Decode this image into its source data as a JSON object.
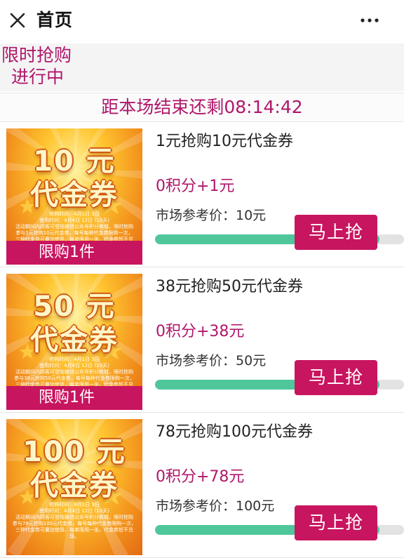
{
  "header": {
    "title": "首页",
    "close_icon": "close-icon",
    "more_icon": "more-dots-icon"
  },
  "tag": {
    "line1": "限时抢购",
    "line2": "进行中"
  },
  "countdown": {
    "text": "距本场结束还剩08:14:42"
  },
  "colors": {
    "accent": "#b0176b",
    "button": "#c8155f",
    "progress": "#4fc79a"
  },
  "items": [
    {
      "image": {
        "amount": "10 元",
        "kind": "代金券",
        "limit": "限购1件",
        "fine": [
          "抢购时间：4月1日 3日",
          "使用时间：4月4日 12日 (10天)",
          "活动期间内顾客可登陆微信公众号积分商城，限时抢购",
          "参与1元抢购10元代金券，每号每种代金券限购一次，",
          "三种代金券可叠加使用，每单限用一张，代金券恕不兑现。"
        ]
      },
      "name": "1元抢购10元代金券",
      "price": "0积分+1元",
      "market": "市场参考价：10元",
      "buy_label": "马上抢",
      "progress": 0.9
    },
    {
      "image": {
        "amount": "50 元",
        "kind": "代金券",
        "limit": "限购1件",
        "fine": [
          "抢购时间：4月1日 3日",
          "使用时间：4月4日 12日 (10天)",
          "活动期间内顾客可登陆微信公众号积分商城，限时抢购",
          "参与38元抢购50元代金券，每号每种代金券限购一次，",
          "三种代金券可叠加使用，每单限用一张，代金券恕不兑现。"
        ]
      },
      "name": "38元抢购50元代金券",
      "price": "0积分+38元",
      "market": "市场参考价：50元",
      "buy_label": "马上抢",
      "progress": 0.9
    },
    {
      "image": {
        "amount": "100 元",
        "kind": "代金券",
        "limit": "",
        "fine": [
          "抢购时间：4月1日 3日",
          "使用时间：4月4日 12日 (10天)",
          "活动期间内顾客可登陆微信公众号积分商城，限时抢购",
          "参与78元抢购100元代金券，每号每种代金券限购一次，",
          "三种代金券可叠加使用，每单限用一张，代金券恕不兑现。"
        ]
      },
      "name": "78元抢购100元代金券",
      "price": "0积分+78元",
      "market": "市场参考价：100元",
      "buy_label": "马上抢",
      "progress": 0.9
    }
  ]
}
